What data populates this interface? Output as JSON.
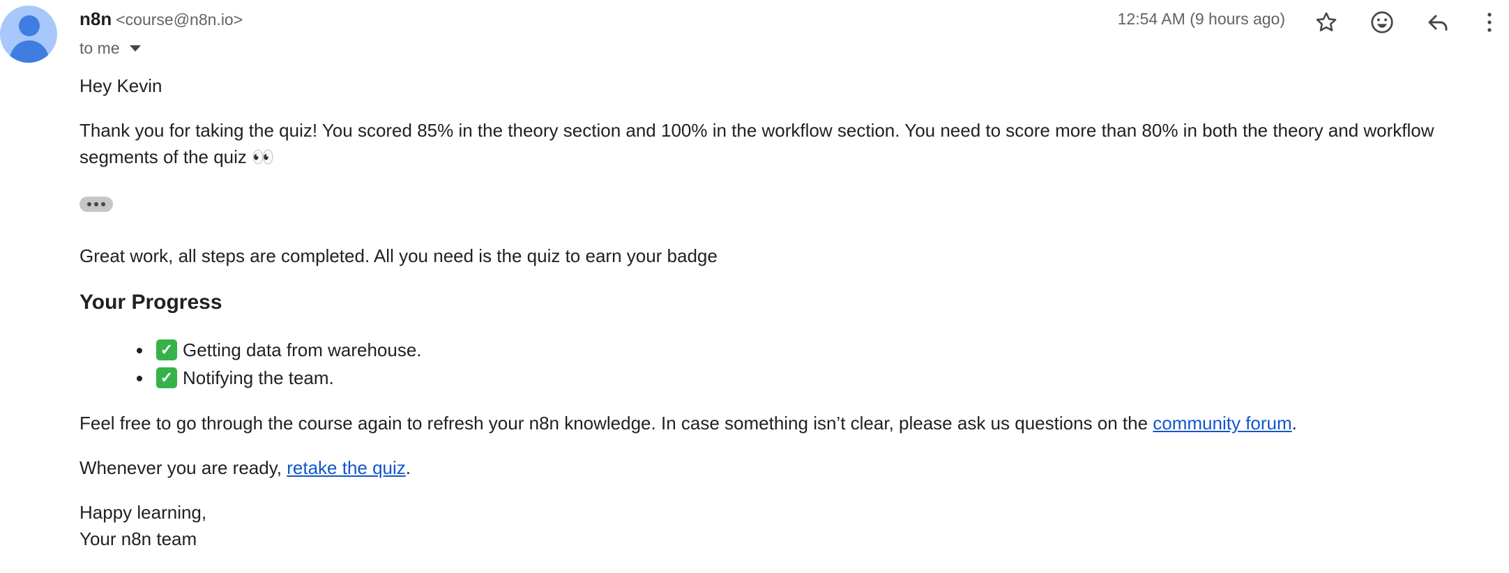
{
  "header": {
    "sender_name": "n8n",
    "sender_email": "<course@n8n.io>",
    "recipient": "to me",
    "timestamp": "12:54 AM (9 hours ago)"
  },
  "icons": {
    "avatar": "person-avatar-icon",
    "star": "star-icon",
    "emoji": "emoji-reaction-icon",
    "reply": "reply-icon",
    "more": "more-vertical-icon",
    "caret": "chevron-down-icon",
    "check": "check-mark-icon"
  },
  "colors": {
    "link": "#1155cc",
    "avatar_bg": "#a8c7fa",
    "avatar_fg": "#3f7de0",
    "check_bg": "#36b24a"
  },
  "body": {
    "greeting": "Hey Kevin",
    "quiz_result": "Thank you for taking the quiz! You scored 85% in the theory section and 100% in the workflow section. You need to score more than 80% in both the theory and workflow segments of the quiz 👀",
    "completed": "Great work, all steps are completed. All you need is the quiz to earn your badge",
    "progress_title": "Your Progress",
    "progress_items": [
      {
        "check": "✓",
        "label": "Getting data from warehouse."
      },
      {
        "check": "✓",
        "label": "Notifying the team."
      }
    ],
    "forum_text": "Feel free to go through the course again to refresh your n8n knowledge. In case something isn’t clear, please ask us questions on the ",
    "forum_link": "community forum",
    "forum_end": ".",
    "retake_text": "Whenever you are ready, ",
    "retake_link": "retake the quiz",
    "retake_end": ".",
    "signoff_1": "Happy learning,",
    "signoff_2": "Your n8n team"
  }
}
